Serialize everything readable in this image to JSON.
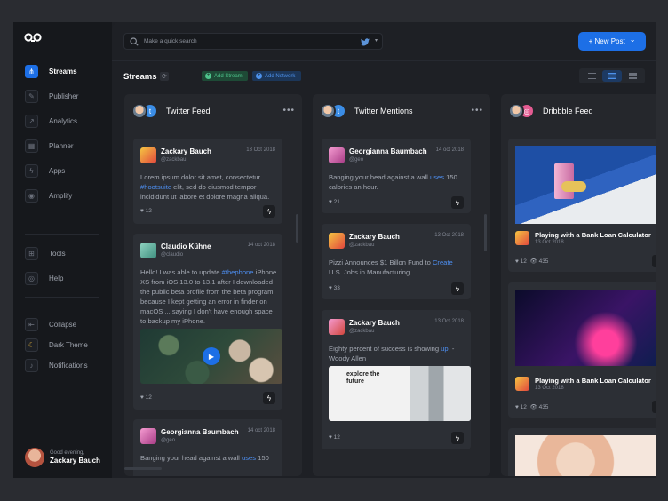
{
  "app": {
    "logo_icon": "infinity-logo-icon"
  },
  "sidebar": {
    "items": [
      {
        "label": "Streams",
        "icon": "streams-icon"
      },
      {
        "label": "Publisher",
        "icon": "publisher-icon"
      },
      {
        "label": "Analytics",
        "icon": "analytics-icon"
      },
      {
        "label": "Planner",
        "icon": "calendar-icon"
      },
      {
        "label": "Apps",
        "icon": "apps-icon"
      },
      {
        "label": "Amplify",
        "icon": "amplify-icon"
      },
      {
        "label": "Tools",
        "icon": "tools-icon"
      },
      {
        "label": "Help",
        "icon": "help-icon"
      },
      {
        "label": "Collapse",
        "icon": "collapse-icon"
      },
      {
        "label": "Dark Theme",
        "icon": "moon-icon"
      },
      {
        "label": "Notifications",
        "icon": "bell-icon"
      }
    ],
    "user": {
      "greeting": "Good evening,",
      "name": "Zackary Bauch"
    }
  },
  "header": {
    "search_placeholder": "Make a quick search",
    "new_post_label": "+ New Post",
    "new_post_chevron": "⌄"
  },
  "toolbar": {
    "title": "Streams",
    "add_stream": "Add Stream",
    "add_network": "Add Network"
  },
  "columns": [
    {
      "title": "Twitter Feed",
      "network_icon": "twitter-icon",
      "cards": [
        {
          "name": "Zackary Bauch",
          "handle": "@zackbau",
          "date": "13 Oct 2018",
          "text_parts": [
            "Lorem ipsum dolor sit amet, consectetur ",
            "#hootsuite",
            " elit, sed do eiusmod tempor incididunt ut labore et dolore magna aliqua."
          ],
          "likes": "12"
        },
        {
          "name": "Claudio Kühne",
          "handle": "@claudio",
          "date": "14 oct 2018",
          "text_parts": [
            "Hello! I was able to update ",
            "#thephone",
            " iPhone XS from iOS 13.0 to 13.1 after I downloaded the public beta profile from the beta program because I kept getting an error in finder on macOS ... saying I don't have enough space to backup my iPhone."
          ],
          "likes": "12"
        },
        {
          "name": "Georgianna Baumbach",
          "handle": "@geo",
          "date": "14 oct 2018",
          "text_parts": [
            "Banging your head against a wall ",
            "uses",
            " 150"
          ],
          "likes": ""
        }
      ]
    },
    {
      "title": "Twitter Mentions",
      "network_icon": "twitter-icon",
      "cards": [
        {
          "name": "Georgianna Baumbach",
          "handle": "@geo",
          "date": "14 oct 2018",
          "text_parts": [
            "Banging your head against a wall ",
            "uses",
            " 150 calories an hour."
          ],
          "likes": "21"
        },
        {
          "name": "Zackary Bauch",
          "handle": "@zackbau",
          "date": "13 Oct 2018",
          "text_parts": [
            "Pizzi Announces $1 Billon Fund to ",
            "Create",
            " U.S. Jobs in Manufacturing"
          ],
          "likes": "33"
        },
        {
          "name": "Zackary Bauch",
          "handle": "@zackbau",
          "date": "13 Oct 2018",
          "text_parts": [
            "Eighty percent of success is showing ",
            "up.",
            " - Woody Allen"
          ],
          "likes": "12",
          "image_text": "explore the future"
        }
      ]
    },
    {
      "title": "Dribbble Feed",
      "network_icon": "dribbble-icon",
      "cards": [
        {
          "title": "Playing with a Bank Loan Calculator",
          "date": "13 Oct 2018",
          "likes": "12",
          "views": "435"
        },
        {
          "title": "Playing with a Bank Loan Calculator",
          "date": "13 Oct 2018",
          "likes": "12",
          "views": "435"
        }
      ]
    }
  ]
}
